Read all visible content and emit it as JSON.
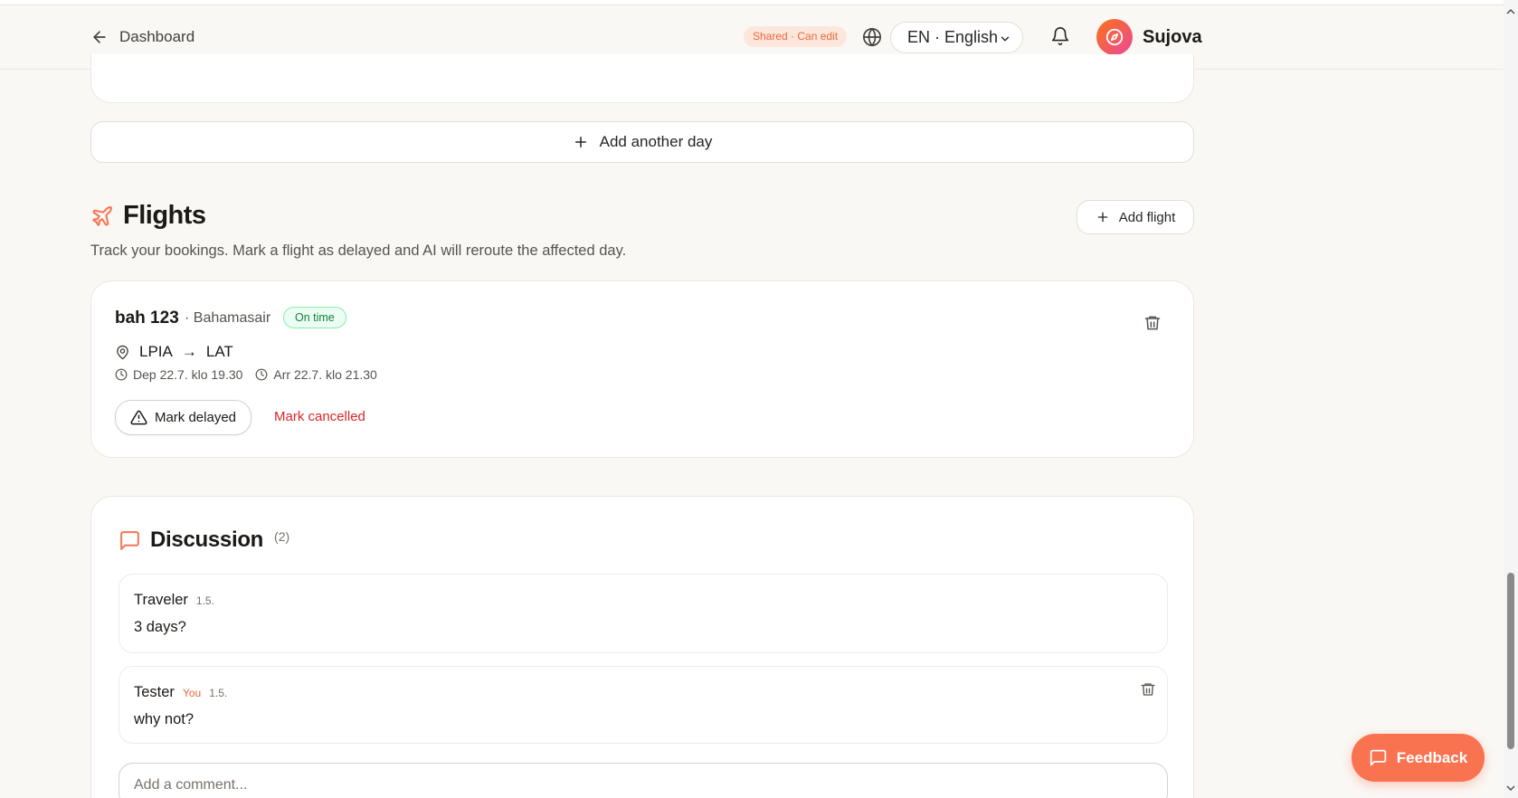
{
  "header": {
    "back_label": "Dashboard",
    "shared_badge": "Shared · Can edit",
    "language": "EN · English",
    "brand": "Sujova"
  },
  "itinerary": {
    "add_day_label": "Add another day"
  },
  "flights": {
    "title": "Flights",
    "subtitle": "Track your bookings. Mark a flight as delayed and AI will reroute the affected day.",
    "add_label": "Add flight",
    "items": [
      {
        "code": "bah 123",
        "airline": "· Bahamasair",
        "status": "On time",
        "from": "LPIA",
        "arrow": "→",
        "to": "LAT",
        "departure": "Dep 22.7. klo 19.30",
        "arrival": "Arr 22.7. klo 21.30",
        "mark_delayed_label": "Mark delayed",
        "mark_cancelled_label": "Mark cancelled"
      }
    ]
  },
  "discussion": {
    "title": "Discussion",
    "count": "(2)",
    "comments": [
      {
        "author": "Traveler",
        "date": "1.5.",
        "body": "3 days?"
      },
      {
        "author": "Tester",
        "you": "You",
        "date": "1.5.",
        "body": "why not?"
      }
    ],
    "input_placeholder": "Add a comment..."
  },
  "feedback_label": "Feedback",
  "colors": {
    "accent": "#f97350",
    "badge_text": "#e8693d",
    "status_green": "#15803d",
    "danger": "#dc2626",
    "background": "#faf8f5"
  },
  "icons": {
    "back": "arrow-left-icon",
    "language": "globe-icon",
    "notifications": "bell-icon",
    "brand_logo": "compass-icon",
    "flights": "plane-icon",
    "delete": "trash-icon",
    "location": "map-pin-icon",
    "time": "clock-icon",
    "warning": "alert-triangle-icon",
    "discussion": "message-square-icon",
    "feedback": "message-square-icon"
  }
}
